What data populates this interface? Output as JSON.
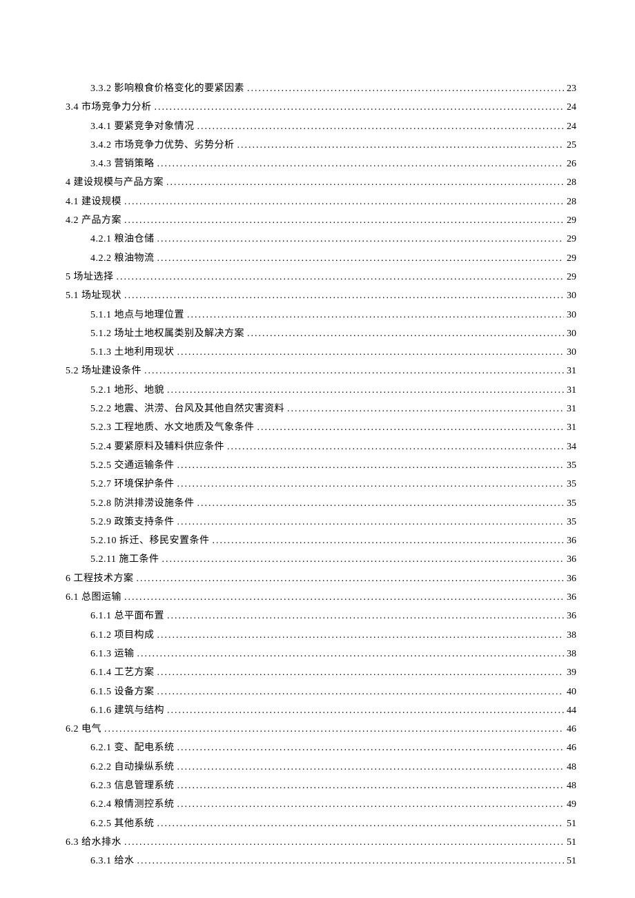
{
  "toc": [
    {
      "level": 3,
      "label": "3.3.2 影响粮食价格变化的要紧因素",
      "page": "23"
    },
    {
      "level": 2,
      "label": "3.4 市场竞争力分析",
      "page": "24"
    },
    {
      "level": 3,
      "label": "3.4.1 要紧竞争对象情况",
      "page": "24"
    },
    {
      "level": 3,
      "label": "3.4.2 市场竞争力优势、劣势分析",
      "page": "25"
    },
    {
      "level": 3,
      "label": "3.4.3 营销策略",
      "page": "26"
    },
    {
      "level": 1,
      "label": "4 建设规模与产品方案",
      "page": "28"
    },
    {
      "level": 2,
      "label": "4.1 建设规模",
      "page": "28"
    },
    {
      "level": 2,
      "label": "4.2 产品方案",
      "page": "29"
    },
    {
      "level": 3,
      "label": "4.2.1 粮油仓储",
      "page": "29"
    },
    {
      "level": 3,
      "label": "4.2.2 粮油物流",
      "page": "29"
    },
    {
      "level": 1,
      "label": "5 场址选择",
      "page": "29"
    },
    {
      "level": 2,
      "label": "5.1 场址现状",
      "page": "30"
    },
    {
      "level": 3,
      "label": "5.1.1 地点与地理位置",
      "page": "30"
    },
    {
      "level": 3,
      "label": "5.1.2 场址土地权属类别及解决方案",
      "page": "30"
    },
    {
      "level": 3,
      "label": "5.1.3 土地利用现状",
      "page": "30"
    },
    {
      "level": 2,
      "label": "5.2 场址建设条件",
      "page": "31"
    },
    {
      "level": 3,
      "label": "5.2.1 地形、地貌",
      "page": "31"
    },
    {
      "level": 3,
      "label": "5.2.2 地震、洪涝、台风及其他自然灾害资料",
      "page": "31"
    },
    {
      "level": 3,
      "label": "5.2.3 工程地质、水文地质及气象条件",
      "page": "31"
    },
    {
      "level": 3,
      "label": "5.2.4 要紧原料及辅料供应条件",
      "page": "34"
    },
    {
      "level": 3,
      "label": "5.2.5 交通运输条件",
      "page": "35"
    },
    {
      "level": 3,
      "label": "5.2.7 环境保护条件",
      "page": "35"
    },
    {
      "level": 3,
      "label": "5.2.8 防洪排涝设施条件",
      "page": "35"
    },
    {
      "level": 3,
      "label": "5.2.9 政策支持条件",
      "page": "35"
    },
    {
      "level": 3,
      "label": "5.2.10 拆迁、移民安置条件",
      "page": "36"
    },
    {
      "level": 3,
      "label": "5.2.11 施工条件",
      "page": "36"
    },
    {
      "level": 1,
      "label": "6 工程技术方案",
      "page": "36"
    },
    {
      "level": 2,
      "label": "6.1 总图运输",
      "page": "36"
    },
    {
      "level": 3,
      "label": "6.1.1 总平面布置",
      "page": "36"
    },
    {
      "level": 3,
      "label": "6.1.2 项目构成",
      "page": "38"
    },
    {
      "level": 3,
      "label": "6.1.3 运输",
      "page": "38"
    },
    {
      "level": 3,
      "label": "6.1.4 工艺方案",
      "page": "39"
    },
    {
      "level": 3,
      "label": "6.1.5 设备方案",
      "page": "40"
    },
    {
      "level": 3,
      "label": "6.1.6 建筑与结构",
      "page": "44"
    },
    {
      "level": 2,
      "label": "6.2 电气",
      "page": "46"
    },
    {
      "level": 3,
      "label": "6.2.1 变、配电系统",
      "page": "46"
    },
    {
      "level": 3,
      "label": "6.2.2 自动操纵系统",
      "page": "48"
    },
    {
      "level": 3,
      "label": "6.2.3 信息管理系统",
      "page": "48"
    },
    {
      "level": 3,
      "label": "6.2.4 粮情测控系统",
      "page": "49"
    },
    {
      "level": 3,
      "label": "6.2.5 其他系统",
      "page": "51"
    },
    {
      "level": 2,
      "label": "6.3 给水排水",
      "page": "51"
    },
    {
      "level": 3,
      "label": "6.3.1 给水",
      "page": "51"
    }
  ]
}
